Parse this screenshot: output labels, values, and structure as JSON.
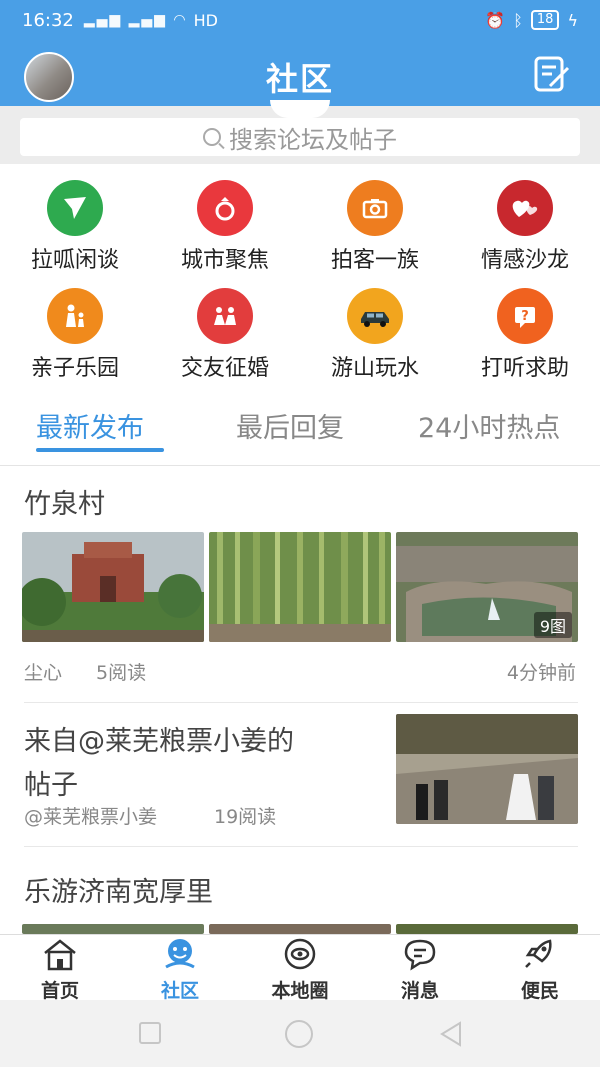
{
  "status_bar": {
    "time": "16:32",
    "signal": "HD",
    "battery": "18"
  },
  "header": {
    "title": "社区"
  },
  "search": {
    "placeholder": "搜索论坛及帖子"
  },
  "categories": [
    {
      "label": "拉呱闲谈",
      "color": "#2eaa4f",
      "icon": "paper-plane-icon"
    },
    {
      "label": "城市聚焦",
      "color": "#e9383d",
      "icon": "ring-icon"
    },
    {
      "label": "拍客一族",
      "color": "#ee7d1f",
      "icon": "camera-icon"
    },
    {
      "label": "情感沙龙",
      "color": "#c8282e",
      "icon": "hearts-icon"
    },
    {
      "label": "亲子乐园",
      "color": "#f08a1c",
      "icon": "family-icon"
    },
    {
      "label": "交友征婚",
      "color": "#e23d3d",
      "icon": "couple-icon"
    },
    {
      "label": "游山玩水",
      "color": "#f2a51e",
      "icon": "car-icon"
    },
    {
      "label": "打听求助",
      "color": "#f0621f",
      "icon": "question-icon"
    }
  ],
  "tabs": [
    {
      "label": "最新发布",
      "active": true
    },
    {
      "label": "最后回复",
      "active": false
    },
    {
      "label": "24小时热点",
      "active": false
    }
  ],
  "posts": [
    {
      "title": "竹泉村",
      "author": "尘心",
      "reads": "5阅读",
      "time": "4分钟前",
      "image_count": "9图"
    },
    {
      "title_line1": "来自@莱芜粮票小姜的",
      "title_line2": "帖子",
      "author": "@莱芜粮票小姜",
      "reads": "19阅读"
    },
    {
      "title": "乐游济南宽厚里"
    }
  ],
  "bottom_nav": [
    {
      "label": "首页",
      "icon": "home-icon"
    },
    {
      "label": "社区",
      "icon": "community-icon",
      "active": true
    },
    {
      "label": "本地圈",
      "icon": "local-circle-icon"
    },
    {
      "label": "消息",
      "icon": "message-icon"
    },
    {
      "label": "便民",
      "icon": "rocket-icon"
    }
  ],
  "colors": {
    "brand": "#4a9fe6",
    "active": "#3a93e0"
  }
}
